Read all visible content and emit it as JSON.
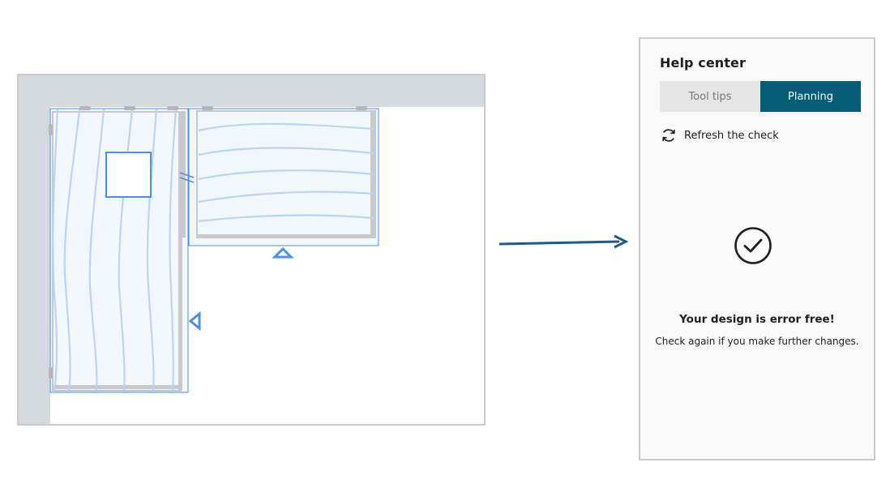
{
  "help_center": {
    "title": "Help center",
    "tabs": [
      {
        "label": "Tool tips",
        "active": false
      },
      {
        "label": "Planning",
        "active": true
      }
    ],
    "refresh_label": "Refresh the check",
    "status_title": "Your design is error free!",
    "status_subtitle": "Check again if you make further changes."
  },
  "colors": {
    "accent": "#055d75",
    "tab_inactive_bg": "#e5e5e5",
    "selection_blue": "#4b8ff0",
    "wall_gray": "#d5d9e0",
    "arrow": "#1c5a8c"
  },
  "icons": {
    "refresh": "refresh-icon",
    "check": "check-circle-icon",
    "arrow": "arrow-right-icon"
  }
}
